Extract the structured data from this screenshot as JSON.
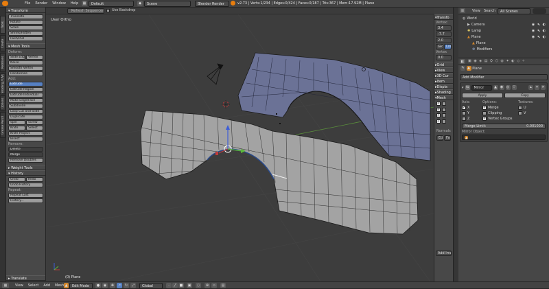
{
  "topbar": {
    "menus": [
      "File",
      "Render",
      "Window",
      "Help"
    ],
    "layout": "Default",
    "scene": "Scene",
    "engine": "Blender Render",
    "stats": "v2.73 | Verts:1/234 | Edges:0/424 | Faces:0/187 | Tris:367 | Mem:17.92M | Plane"
  },
  "header_row": {
    "refresh_label": "Refresh Sequencer",
    "backdrop_label": "Use Backdrop"
  },
  "tool_tabs": [
    "Tools",
    "Create",
    "Relations",
    "Shading / UVs",
    "Options",
    "Grease Pencil"
  ],
  "toolshelf": {
    "transform_header": "Transform",
    "transform": [
      "Translate",
      "Rotate",
      "Scale",
      "Shrink/Fatten",
      "Push/Pull"
    ],
    "mesh_tools_header": "Mesh Tools",
    "deform_label": "Deform:",
    "slide": [
      "Slide Edge",
      "Vertex"
    ],
    "deform_items": [
      "Noise",
      "Smooth Vertex",
      "Randomize"
    ],
    "add_label": "Add:",
    "extrude": "Extrude",
    "add_items": [
      "Extrude Region",
      "Extrude Individual",
      "Make Edge/Face",
      "Subdivide",
      "Loop Cut and Slide",
      "Duplicate"
    ],
    "spin_screw": [
      "Spin",
      "Screw"
    ],
    "knife_select": [
      "Knife",
      "Select"
    ],
    "add_items2": [
      "Knife Project",
      "Bisect"
    ],
    "remove_label": "Remove:",
    "delete": "Delete",
    "merge": "Merge",
    "remove_doubles": "Remove Doubles",
    "weight_tools_header": "Weight Tools",
    "history_header": "History",
    "undo_redo": [
      "Undo",
      "Redo"
    ],
    "history_items": [
      "Undo History"
    ],
    "repeat_label": "Repeat:",
    "repeat_items": [
      "Repeat Last",
      "History..."
    ],
    "operator_panel": "Translate"
  },
  "viewport": {
    "view_label": "User Ortho",
    "object_label": "(0) Plane"
  },
  "n_panel": {
    "transform_header": "Transfo",
    "vertex_label": "Vertex:",
    "x": "3.4",
    "y": "-7.7",
    "z": "2.0",
    "global_local": [
      "Glo",
      "Loc"
    ],
    "vertex2_label": "Vertex",
    "v2": "0.0",
    "sections": [
      "Grid",
      "View",
      "3D Cur",
      "Item",
      "Displa",
      "Shading",
      "Mesh"
    ],
    "normals_label": "Normals",
    "ed_fa": [
      "Ed",
      "Fa"
    ],
    "bottom_button": "Add Ima"
  },
  "outliner": {
    "menus": [
      "View",
      "Search"
    ],
    "filter": "All Scenes",
    "items": [
      {
        "label": "World",
        "depth": 0
      },
      {
        "label": "Camera",
        "depth": 1
      },
      {
        "label": "Lamp",
        "depth": 1
      },
      {
        "label": "Plane",
        "depth": 1
      },
      {
        "label": "Plane",
        "depth": 2
      },
      {
        "label": "Modifiers",
        "depth": 2
      }
    ]
  },
  "properties": {
    "breadcrumb": "Plane",
    "add_modifier": "Add Modifier",
    "modifier_name": "Mirror",
    "apply": "Apply",
    "copy": "Copy",
    "axis_label": "Axis:",
    "options_label": "Options:",
    "textures_label": "Textures:",
    "axes": [
      {
        "label": "X",
        "checked": true
      },
      {
        "label": "Y",
        "checked": false
      },
      {
        "label": "Z",
        "checked": false
      }
    ],
    "options": [
      {
        "label": "Merge",
        "checked": true
      },
      {
        "label": "Clipping",
        "checked": false
      },
      {
        "label": "Vertex Groups",
        "checked": true
      }
    ],
    "textures": [
      {
        "label": "U",
        "checked": false
      },
      {
        "label": "V",
        "checked": false
      }
    ],
    "merge_limit_label": "Merge Limit:",
    "merge_limit_value": "0.001000",
    "mirror_object_label": "Mirror Object:"
  },
  "bottombar": {
    "menus": [
      "View",
      "Select",
      "Add",
      "Mesh"
    ],
    "mode": "Edit Mode",
    "orientation": "Global"
  },
  "colors": {
    "viewport_bg": "#3d3d3d",
    "mesh_grey": "#a3a3a3",
    "mesh_blue": "#6b7296",
    "selected_blue": "#5680c2",
    "x_axis": "#b84545",
    "y_axis": "#6fa84a"
  }
}
